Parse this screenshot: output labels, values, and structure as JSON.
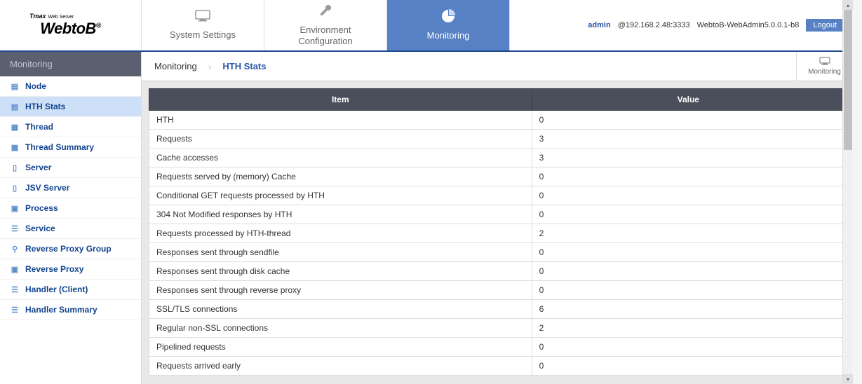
{
  "logo": {
    "small": "Tmax",
    "small_sub": "Web Server",
    "main": "WebtoB",
    "reg": "®"
  },
  "nav": [
    {
      "label": "System Settings"
    },
    {
      "label": "Environment\nConfiguration"
    },
    {
      "label": "Monitoring"
    }
  ],
  "header_right": {
    "user": "admin",
    "addr": "@192.168.2.48:3333",
    "version": "WebtoB-WebAdmin5.0.0.1-b8",
    "logout": "Logout"
  },
  "sidebar": {
    "header": "Monitoring",
    "items": [
      {
        "label": "Node"
      },
      {
        "label": "HTH Stats"
      },
      {
        "label": "Thread"
      },
      {
        "label": "Thread Summary"
      },
      {
        "label": "Server"
      },
      {
        "label": "JSV Server"
      },
      {
        "label": "Process"
      },
      {
        "label": "Service"
      },
      {
        "label": "Reverse Proxy Group"
      },
      {
        "label": "Reverse Proxy"
      },
      {
        "label": "Handler (Client)"
      },
      {
        "label": "Handler Summary"
      }
    ]
  },
  "breadcrumb": {
    "root": "Monitoring",
    "current": "HTH Stats",
    "right_label": "Monitoring"
  },
  "table": {
    "headers": {
      "item": "Item",
      "value": "Value"
    },
    "rows": [
      {
        "item": "HTH",
        "value": "0"
      },
      {
        "item": "Requests",
        "value": "3"
      },
      {
        "item": "Cache accesses",
        "value": "3"
      },
      {
        "item": "Requests served by (memory) Cache",
        "value": "0"
      },
      {
        "item": "Conditional GET requests processed by HTH",
        "value": "0"
      },
      {
        "item": "304 Not Modified responses by HTH",
        "value": "0"
      },
      {
        "item": "Requests processed by HTH-thread",
        "value": "2"
      },
      {
        "item": "Responses sent through sendfile",
        "value": "0"
      },
      {
        "item": "Responses sent through disk cache",
        "value": "0"
      },
      {
        "item": "Responses sent through reverse proxy",
        "value": "0"
      },
      {
        "item": "SSL/TLS connections",
        "value": "6"
      },
      {
        "item": "Regular non-SSL connections",
        "value": "2"
      },
      {
        "item": "Pipelined requests",
        "value": "0"
      },
      {
        "item": "Requests arrived early",
        "value": "0"
      }
    ]
  }
}
